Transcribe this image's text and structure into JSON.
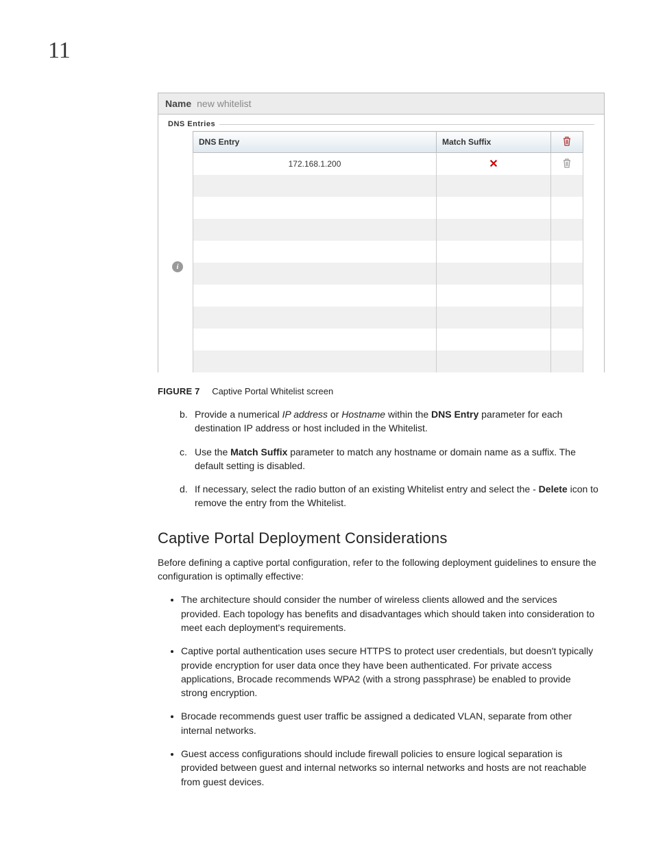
{
  "page": {
    "number": "11"
  },
  "figure": {
    "name_label": "Name",
    "name_value": "new whitelist",
    "fieldset_title": "DNS Entries",
    "columns": {
      "entry": "DNS Entry",
      "suffix": "Match Suffix"
    },
    "row1": {
      "entry": "172.168.1.200"
    },
    "caption_label": "FIGURE 7",
    "caption_text": "Captive Portal Whitelist screen"
  },
  "steps": {
    "b": {
      "marker": "b.",
      "pre": "Provide a numerical ",
      "em1": "IP address",
      "mid1": " or ",
      "em2": "Hostname",
      "mid2": " within the ",
      "bold": "DNS Entry",
      "post": " parameter for each destination IP address or host included in the Whitelist."
    },
    "c": {
      "marker": "c.",
      "pre": "Use the ",
      "bold": "Match Suffix",
      "post": " parameter to match any hostname or domain name as a suffix. The default setting is disabled."
    },
    "d": {
      "marker": "d.",
      "pre": "If necessary, select the radio button of an existing Whitelist entry and select the - ",
      "bold": "Delete",
      "post": " icon to remove the entry from the Whitelist."
    }
  },
  "section": {
    "heading": "Captive Portal Deployment Considerations",
    "intro": "Before defining a captive portal configuration, refer to the following deployment guidelines to ensure the configuration is optimally effective:",
    "bullets": [
      "The architecture should consider the number of wireless clients allowed and the services provided. Each topology has benefits and disadvantages which should taken into consideration to meet each deployment's requirements.",
      "Captive portal authentication uses secure HTTPS to protect user credentials, but doesn't typically provide encryption for user data once they have been authenticated. For private access applications, Brocade recommends WPA2 (with a strong passphrase) be enabled to provide strong encryption.",
      "Brocade recommends guest user traffic be assigned a dedicated VLAN, separate from other internal networks.",
      "Guest access configurations should include firewall policies to ensure logical separation is provided between guest and internal networks so internal networks and hosts are not reachable from guest devices."
    ]
  }
}
